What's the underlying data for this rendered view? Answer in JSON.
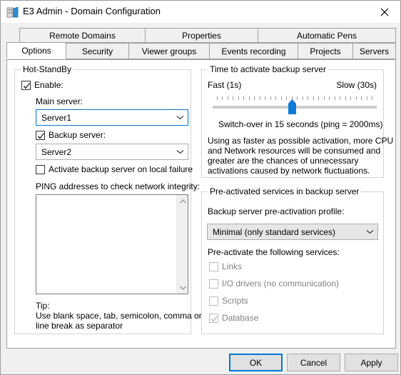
{
  "window": {
    "title": "E3 Admin - Domain Configuration",
    "icon": "building-icon",
    "close_icon": "close-icon"
  },
  "tabs": {
    "row1": [
      {
        "label": "Remote Domains",
        "selected": false
      },
      {
        "label": "Properties",
        "selected": false
      },
      {
        "label": "Automatic Pens",
        "selected": false
      }
    ],
    "row2": [
      {
        "label": "Options",
        "selected": true
      },
      {
        "label": "Security",
        "selected": false
      },
      {
        "label": "Viewer groups",
        "selected": false
      },
      {
        "label": "Events recording",
        "selected": false
      },
      {
        "label": "Projects",
        "selected": false
      },
      {
        "label": "Servers",
        "selected": false
      }
    ]
  },
  "hot_standby": {
    "group_label": "Hot-StandBy",
    "enable_label": "Enable:",
    "enable_checked": true,
    "main_server_label": "Main server:",
    "main_server_value": "Server1",
    "backup_server_label": "Backup server:",
    "backup_server_checked": true,
    "backup_server_value": "Server2",
    "activate_local_failure_label": "Activate backup server on local failure",
    "activate_local_failure_checked": false,
    "ping_label": "PING addresses to check network integrity:",
    "ping_value": "",
    "ping_placeholder": "",
    "tip_title": "Tip:",
    "tip_line1": "Use blank space, tab, semicolon, comma or",
    "tip_line2": "line break as separator"
  },
  "time_to_activate": {
    "group_label": "Time to activate backup server",
    "min_label": "Fast (1s)",
    "max_label": "Slow (30s)",
    "slider_value": 15,
    "slider_min": 1,
    "slider_max": 30,
    "tick_count": 30,
    "status_text": "Switch-over in 15 seconds (ping = 2000ms)",
    "description_line1": "Using as faster as possible activation, more CPU",
    "description_line2": "and Network resources will be consumed and",
    "description_line3": "greater are the chances of unnecessary",
    "description_line4": "activations caused by network fluctuations."
  },
  "pre_activated": {
    "group_label": "Pre-activated services in backup server",
    "profile_label": "Backup server pre-activation profile:",
    "profile_value": "Minimal (only standard services)",
    "services_label": "Pre-activate the following services:",
    "services": [
      {
        "label": "Links",
        "checked": false,
        "enabled": false
      },
      {
        "label": "I/O drivers (no communication)",
        "checked": false,
        "enabled": false
      },
      {
        "label": "Scripts",
        "checked": false,
        "enabled": false
      },
      {
        "label": "Database",
        "checked": true,
        "enabled": false
      }
    ]
  },
  "footer": {
    "ok_label": "OK",
    "cancel_label": "Cancel",
    "apply_label": "Apply"
  },
  "colors": {
    "accent": "#0078d7",
    "window_bg": "#f0f0f0",
    "panel_bg": "#ffffff",
    "disabled_text": "#828282"
  }
}
